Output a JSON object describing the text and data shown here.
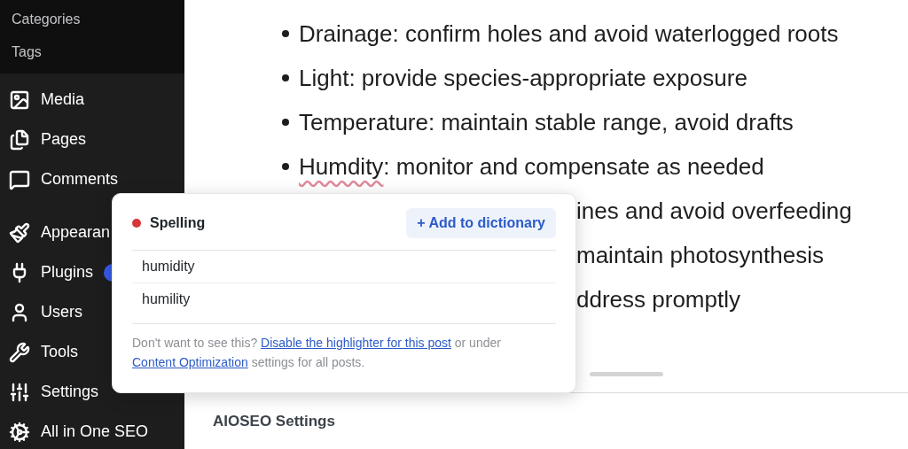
{
  "sidebar": {
    "submenu": [
      "Categories",
      "Tags"
    ],
    "items": [
      {
        "kind": "media",
        "label": "Media"
      },
      {
        "kind": "pages",
        "label": "Pages"
      },
      {
        "kind": "comments",
        "label": "Comments"
      },
      {
        "kind": "appearance",
        "label": "Appearan"
      },
      {
        "kind": "plugins",
        "label": "Plugins",
        "badge": true
      },
      {
        "kind": "users",
        "label": "Users"
      },
      {
        "kind": "tools",
        "label": "Tools"
      },
      {
        "kind": "settings",
        "label": "Settings"
      },
      {
        "kind": "seo",
        "label": "All in One SEO"
      }
    ]
  },
  "content": {
    "bullets": [
      {
        "term": "Drainage",
        "rest": ": confirm holes and avoid waterlogged roots",
        "flagged": false
      },
      {
        "term": "Light",
        "rest": ": provide species-appropriate exposure",
        "flagged": false
      },
      {
        "term": "Temperature",
        "rest": ": maintain stable range, avoid drafts",
        "flagged": false
      },
      {
        "term": "Humdity",
        "rest": ": monitor and compensate as needed",
        "flagged": true
      }
    ],
    "covered_lines": [
      "ines and avoid overfeeding",
      "maintain photosynthesis",
      "ddress promptly"
    ]
  },
  "popover": {
    "title": "Spelling",
    "add_button": "+ Add to dictionary",
    "suggestions": [
      "humidity",
      "humility"
    ],
    "footer": {
      "before": "Don't want to see this?",
      "link1": "Disable the highlighter for this post",
      "middle": "or under",
      "link2": "Content Optimization",
      "after": "settings for all posts."
    }
  },
  "bottom": {
    "title": "AIOSEO Settings"
  }
}
